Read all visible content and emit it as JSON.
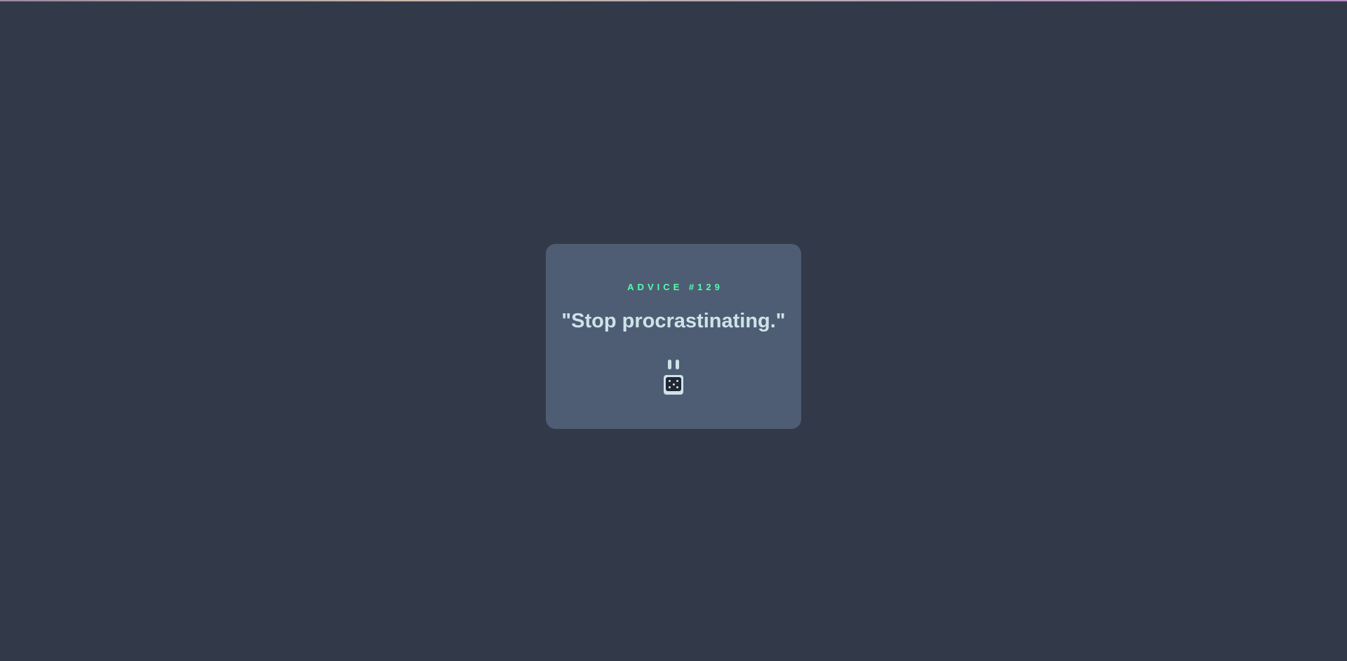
{
  "card": {
    "advice_label": "ADVICE #129",
    "quote": "\"Stop procrastinating.\""
  },
  "icons": {
    "divider": "pause-divider-icon",
    "dice": "dice-icon"
  },
  "colors": {
    "background": "#323a49",
    "card": "#4e5d73",
    "accent": "#53ffaa",
    "text": "#cee3e9",
    "dice_face": "#202733"
  }
}
